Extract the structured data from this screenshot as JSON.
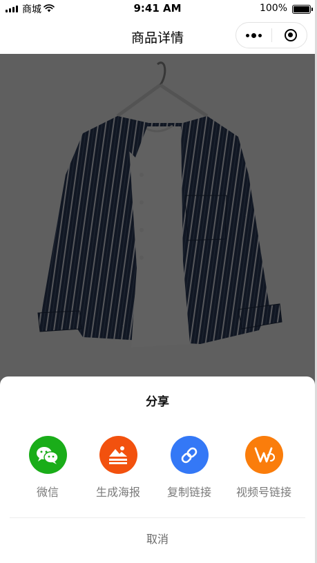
{
  "status_bar": {
    "carrier": "商城",
    "time": "9:41 AM",
    "battery_percent": "100%"
  },
  "nav": {
    "title": "商品详情"
  },
  "product": {
    "image_icon": "striped-shirt-on-hanger"
  },
  "share_sheet": {
    "title": "分享",
    "options": [
      {
        "label": "微信",
        "icon": "wechat-icon",
        "color": "#1AAD19"
      },
      {
        "label": "生成海报",
        "icon": "poster-icon",
        "color": "#F2510E"
      },
      {
        "label": "复制链接",
        "icon": "link-icon",
        "color": "#3478F6"
      },
      {
        "label": "视频号链接",
        "icon": "channels-icon",
        "color": "#FA7D0B"
      }
    ],
    "cancel_label": "取消"
  }
}
